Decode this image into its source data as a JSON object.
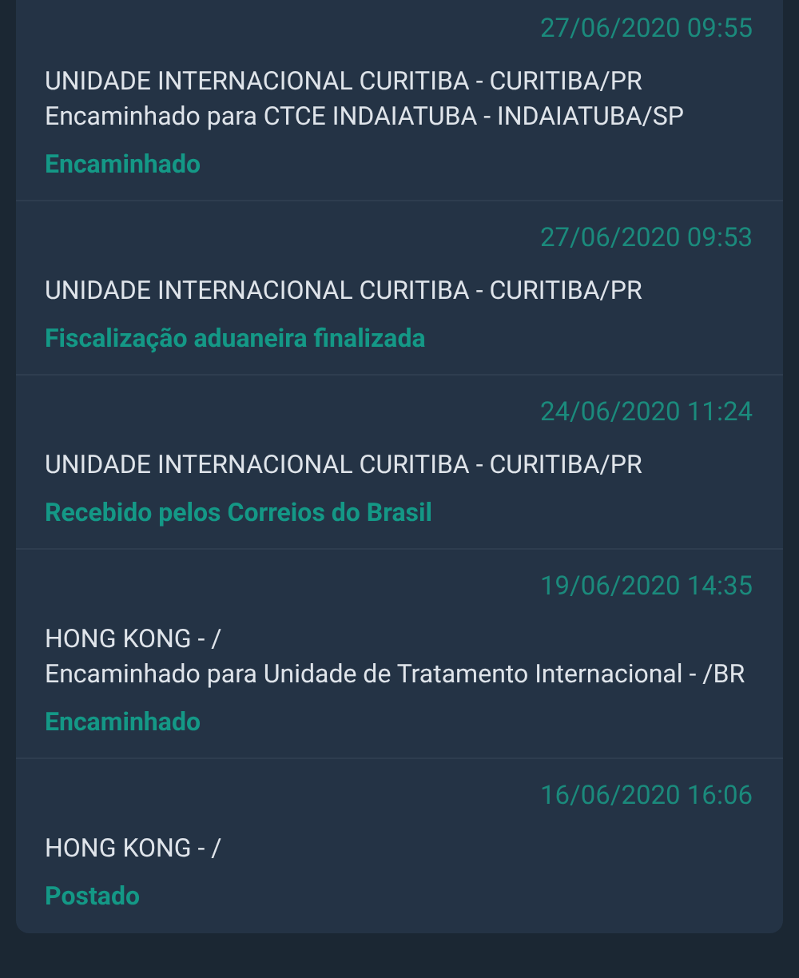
{
  "events": [
    {
      "datetime": "27/06/2020 09:55",
      "location": "UNIDADE INTERNACIONAL CURITIBA - CURITIBA/PR",
      "detail": "Encaminhado para CTCE INDAIATUBA - INDAIATUBA/SP",
      "status": "Encaminhado"
    },
    {
      "datetime": "27/06/2020 09:53",
      "location": "UNIDADE INTERNACIONAL CURITIBA - CURITIBA/PR",
      "status": "Fiscalização aduaneira finalizada"
    },
    {
      "datetime": "24/06/2020 11:24",
      "location": "UNIDADE INTERNACIONAL CURITIBA - CURITIBA/PR",
      "status": "Recebido pelos Correios do Brasil"
    },
    {
      "datetime": "19/06/2020 14:35",
      "location": "HONG KONG - /",
      "detail": "Encaminhado para Unidade de Tratamento Internacional - /BR",
      "status": "Encaminhado"
    },
    {
      "datetime": "16/06/2020 16:06",
      "location": "HONG KONG - /",
      "status": "Postado"
    }
  ]
}
